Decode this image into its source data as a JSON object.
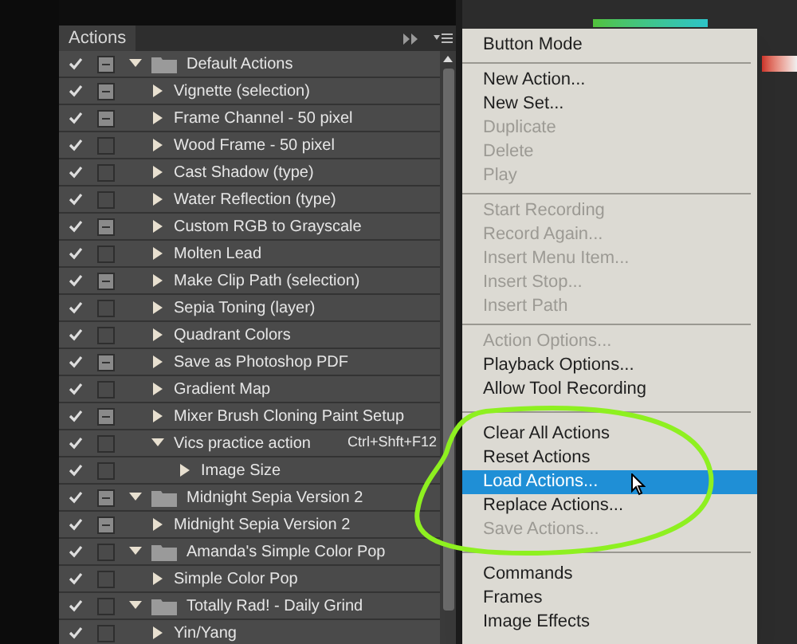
{
  "panel": {
    "title": "Actions"
  },
  "actions": [
    {
      "name": "Default Actions",
      "kind": "set",
      "checked": true,
      "dialog": true,
      "expanded": true,
      "children": [
        {
          "name": "Vignette (selection)",
          "kind": "action",
          "checked": true,
          "dialog": true,
          "expanded": false
        },
        {
          "name": "Frame Channel - 50 pixel",
          "kind": "action",
          "checked": true,
          "dialog": true,
          "expanded": false
        },
        {
          "name": "Wood Frame - 50 pixel",
          "kind": "action",
          "checked": true,
          "dialog": false,
          "expanded": false
        },
        {
          "name": "Cast Shadow (type)",
          "kind": "action",
          "checked": true,
          "dialog": false,
          "expanded": false
        },
        {
          "name": "Water Reflection (type)",
          "kind": "action",
          "checked": true,
          "dialog": false,
          "expanded": false
        },
        {
          "name": "Custom RGB to Grayscale",
          "kind": "action",
          "checked": true,
          "dialog": true,
          "expanded": false
        },
        {
          "name": "Molten Lead",
          "kind": "action",
          "checked": true,
          "dialog": false,
          "expanded": false
        },
        {
          "name": "Make Clip Path (selection)",
          "kind": "action",
          "checked": true,
          "dialog": true,
          "expanded": false
        },
        {
          "name": "Sepia Toning (layer)",
          "kind": "action",
          "checked": true,
          "dialog": false,
          "expanded": false
        },
        {
          "name": "Quadrant Colors",
          "kind": "action",
          "checked": true,
          "dialog": false,
          "expanded": false
        },
        {
          "name": "Save as Photoshop PDF",
          "kind": "action",
          "checked": true,
          "dialog": true,
          "expanded": false
        },
        {
          "name": "Gradient Map",
          "kind": "action",
          "checked": true,
          "dialog": false,
          "expanded": false
        },
        {
          "name": "Mixer Brush Cloning Paint Setup",
          "kind": "action",
          "checked": true,
          "dialog": true,
          "expanded": false
        },
        {
          "name": "Vics practice action",
          "kind": "action",
          "checked": true,
          "dialog": false,
          "expanded": true,
          "shortcut": "Ctrl+Shft+F12",
          "children": [
            {
              "name": "Image Size",
              "kind": "step",
              "checked": true,
              "dialog": false,
              "expanded": false
            }
          ]
        }
      ]
    },
    {
      "name": "Midnight Sepia Version 2",
      "kind": "set",
      "checked": true,
      "dialog": true,
      "expanded": true,
      "children": [
        {
          "name": "Midnight Sepia Version 2",
          "kind": "action",
          "checked": true,
          "dialog": true,
          "expanded": false
        }
      ]
    },
    {
      "name": "Amanda's Simple Color Pop",
      "kind": "set",
      "checked": true,
      "dialog": false,
      "expanded": true,
      "children": [
        {
          "name": "Simple Color Pop",
          "kind": "action",
          "checked": true,
          "dialog": false,
          "expanded": false
        }
      ]
    },
    {
      "name": "Totally Rad! - Daily Grind",
      "kind": "set",
      "checked": true,
      "dialog": false,
      "expanded": true,
      "children": [
        {
          "name": "Yin/Yang",
          "kind": "action",
          "checked": true,
          "dialog": false,
          "expanded": false
        }
      ]
    }
  ],
  "menu": [
    [
      {
        "label": "Button Mode",
        "disabled": false,
        "selected": false
      }
    ],
    [
      {
        "label": "New Action...",
        "disabled": false,
        "selected": false
      },
      {
        "label": "New Set...",
        "disabled": false,
        "selected": false
      },
      {
        "label": "Duplicate",
        "disabled": true,
        "selected": false
      },
      {
        "label": "Delete",
        "disabled": true,
        "selected": false
      },
      {
        "label": "Play",
        "disabled": true,
        "selected": false
      }
    ],
    [
      {
        "label": "Start Recording",
        "disabled": true,
        "selected": false
      },
      {
        "label": "Record Again...",
        "disabled": true,
        "selected": false
      },
      {
        "label": "Insert Menu Item...",
        "disabled": true,
        "selected": false
      },
      {
        "label": "Insert Stop...",
        "disabled": true,
        "selected": false
      },
      {
        "label": "Insert Path",
        "disabled": true,
        "selected": false
      }
    ],
    [
      {
        "label": "Action Options...",
        "disabled": true,
        "selected": false
      },
      {
        "label": "Playback Options...",
        "disabled": false,
        "selected": false
      },
      {
        "label": "Allow Tool Recording",
        "disabled": false,
        "selected": false
      }
    ],
    [
      {
        "label": "Clear All Actions",
        "disabled": false,
        "selected": false
      },
      {
        "label": "Reset Actions",
        "disabled": false,
        "selected": false
      },
      {
        "label": "Load Actions...",
        "disabled": false,
        "selected": true
      },
      {
        "label": "Replace Actions...",
        "disabled": false,
        "selected": false
      },
      {
        "label": "Save Actions...",
        "disabled": true,
        "selected": false
      }
    ],
    [
      {
        "label": "Commands",
        "disabled": false,
        "selected": false
      },
      {
        "label": "Frames",
        "disabled": false,
        "selected": false
      },
      {
        "label": "Image Effects",
        "disabled": false,
        "selected": false
      }
    ]
  ]
}
